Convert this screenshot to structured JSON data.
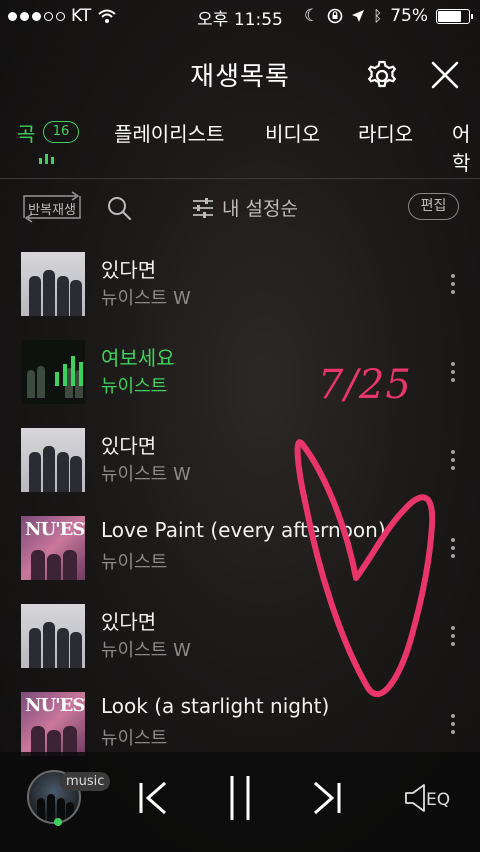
{
  "status_bar": {
    "carrier": "KT",
    "time": "오후 11:55",
    "battery": "75%",
    "battery_level": 0.75
  },
  "header": {
    "title": "재생목록",
    "settings_icon": "gear-icon",
    "close_icon": "close-icon"
  },
  "tabs": [
    {
      "label": "곡",
      "badge": "16",
      "active": true
    },
    {
      "label": "플레이리스트",
      "active": false
    },
    {
      "label": "비디오",
      "active": false
    },
    {
      "label": "라디오",
      "active": false
    },
    {
      "label": "어학",
      "active": false
    }
  ],
  "toolbar": {
    "repeat_label": "반복재생",
    "sort_label": "내 설정순",
    "edit_label": "편집"
  },
  "songs": [
    {
      "title": "있다면",
      "artist": "뉴이스트 W",
      "cover": "nuest-w",
      "active": false
    },
    {
      "title": "여보세요",
      "artist": "뉴이스트",
      "cover": "hello",
      "active": true
    },
    {
      "title": "있다면",
      "artist": "뉴이스트 W",
      "cover": "nuest-w",
      "active": false
    },
    {
      "title": "Love Paint (every afternoon)",
      "artist": "뉴이스트",
      "cover": "nuest",
      "active": false
    },
    {
      "title": "있다면",
      "artist": "뉴이스트 W",
      "cover": "nuest-w",
      "active": false
    },
    {
      "title": "Look (a starlight night)",
      "artist": "뉴이스트",
      "cover": "nuest",
      "active": false
    }
  ],
  "covers": {
    "nuest_word": "NU'EST"
  },
  "annotation": {
    "handwritten_date": "7/25",
    "ink_color": "#e8356a"
  },
  "player": {
    "source_label": "music",
    "eq_label": "EQ"
  },
  "colors": {
    "accent": "#3fd15d"
  }
}
